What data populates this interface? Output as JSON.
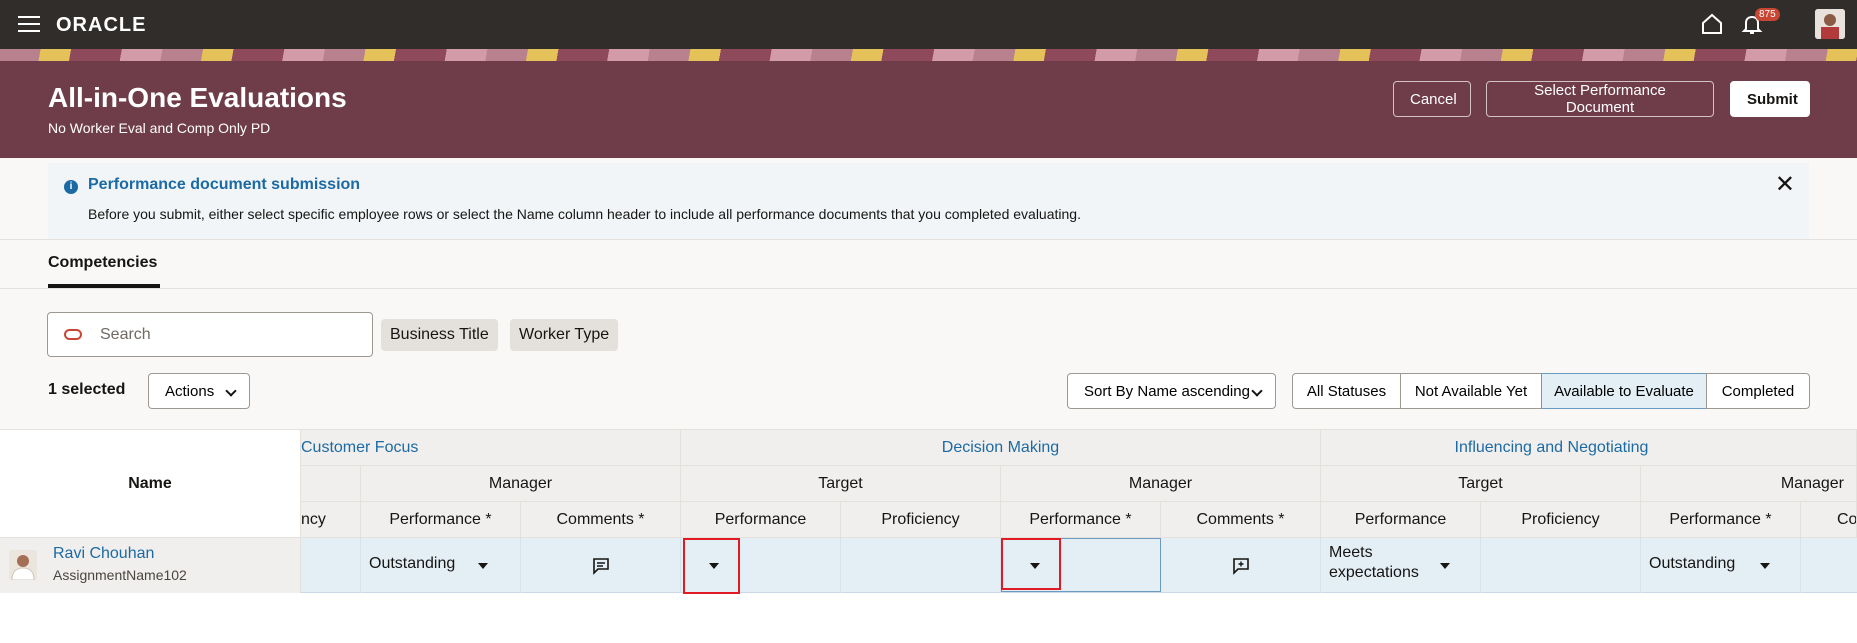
{
  "topbar": {
    "logo": "ORACLE",
    "notification_count": "875"
  },
  "header": {
    "title": "All-in-One Evaluations",
    "subtitle": "No Worker Eval and Comp Only PD",
    "cancel_label": "Cancel",
    "select_doc_label": "Select Performance Document",
    "submit_label": "Submit"
  },
  "message": {
    "title": "Performance document submission",
    "body": "Before you submit, either select specific employee rows or select the Name column header to include all performance documents that you completed evaluating."
  },
  "tabs": [
    {
      "label": "Competencies"
    }
  ],
  "search": {
    "placeholder": "Search"
  },
  "filters": {
    "business_title": "Business Title",
    "worker_type": "Worker Type"
  },
  "toolbar": {
    "selected_count": "1 selected",
    "actions_label": "Actions",
    "sort_prefix": "Sort By",
    "sort_value": "Name ascending",
    "status_filters": [
      "All Statuses",
      "Not Available Yet",
      "Available to Evaluate",
      "Completed"
    ],
    "active_status": "Available to Evaluate"
  },
  "table": {
    "name_header": "Name",
    "groups": [
      "Customer Focus",
      "Decision Making",
      "Influencing and Negotiating"
    ],
    "subgroups": [
      "Manager",
      "Target",
      "Manager",
      "Target",
      "Manager"
    ],
    "columns": [
      "ncy",
      "Performance *",
      "Comments *",
      "Performance",
      "Proficiency",
      "Performance *",
      "Comments *",
      "Performance",
      "Proficiency",
      "Performance *",
      "Co"
    ],
    "row": {
      "name": "Ravi Chouhan",
      "assignment": "AssignmentName102",
      "cf_mgr_performance": "Outstanding",
      "in_tgt_performance_line1": "Meets",
      "in_tgt_performance_line2": "expectations",
      "in_mgr_performance": "Outstanding"
    }
  },
  "colors": {
    "accent_link": "#1c6aa3",
    "banner": "#6f3d4a",
    "topbar": "#312d2a",
    "highlight": "#e01b24"
  }
}
